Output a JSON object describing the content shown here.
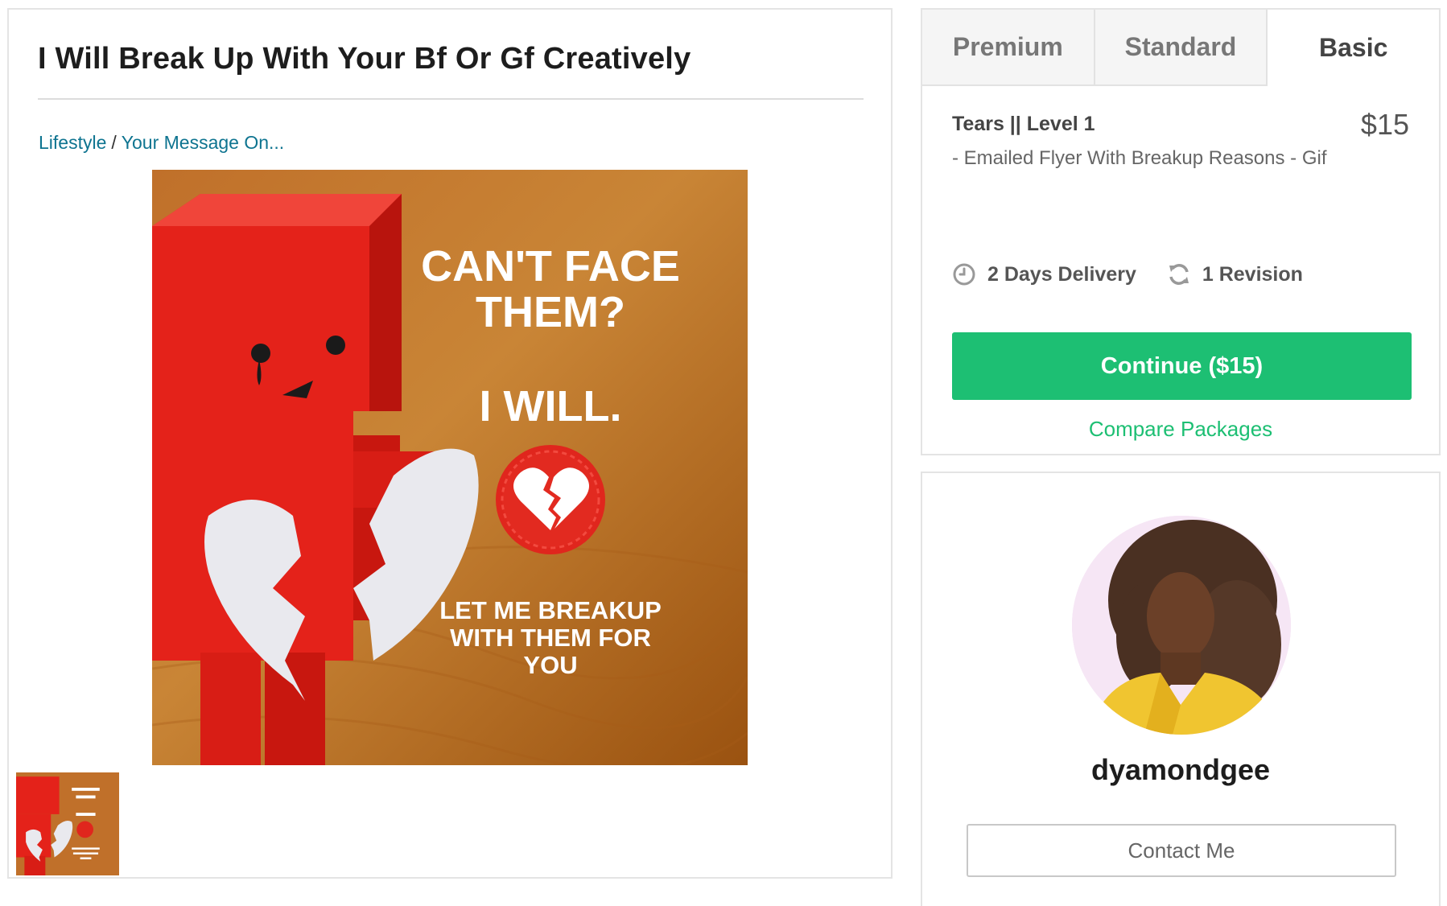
{
  "gig": {
    "title": "I Will Break Up With Your Bf Or Gf Creatively",
    "breadcrumb": {
      "category": "Lifestyle",
      "separator": "/",
      "subcategory": "Your Message On..."
    },
    "image_text": {
      "line1": "CAN'T FACE",
      "line2": "THEM?",
      "line3": "I WILL.",
      "line4": "LET ME BREAKUP",
      "line5": "WITH THEM FOR",
      "line6": "YOU"
    }
  },
  "packages": {
    "tabs": [
      {
        "label": "Premium",
        "active": false
      },
      {
        "label": "Standard",
        "active": false
      },
      {
        "label": "Basic",
        "active": true
      }
    ],
    "selected": {
      "name": "Tears || Level 1",
      "price": "$15",
      "description": "- Emailed Flyer With Breakup Reasons - Gif",
      "delivery": "2 Days Delivery",
      "revisions": "1 Revision"
    },
    "continue_label": "Continue ($15)",
    "compare_label": "Compare Packages"
  },
  "seller": {
    "username": "dyamondgee",
    "contact_label": "Contact Me"
  },
  "colors": {
    "accent_green": "#1dbf73",
    "link_blue": "#0e7490",
    "image_bg": "#b8661c",
    "robot_red": "#e4221a"
  },
  "icons": [
    "clock-icon",
    "refresh-icon",
    "broken-heart-icon"
  ]
}
